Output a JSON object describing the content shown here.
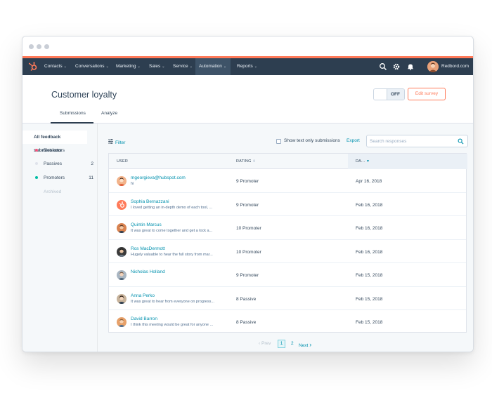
{
  "nav": {
    "items": [
      "Contacts",
      "Conversations",
      "Marketing",
      "Sales",
      "Service",
      "Automation",
      "Reports"
    ],
    "account": "Redbord.com"
  },
  "page": {
    "title": "Customer loyalty",
    "toggle_label": "OFF",
    "edit_button": "Edit survey",
    "tabs": [
      "Submissions",
      "Analyze"
    ]
  },
  "sidebar": {
    "header": "All feedback submissions",
    "items": [
      {
        "label": "Detractors",
        "count": "",
        "color": "#f2547d"
      },
      {
        "label": "Passives",
        "count": "2",
        "color": "#dfe3eb"
      },
      {
        "label": "Promoters",
        "count": "11",
        "color": "#00bda5"
      },
      {
        "label": "Archived",
        "count": "",
        "color": ""
      }
    ]
  },
  "toolbar": {
    "filter": "Filter",
    "checkbox_label": "Show text only submissions",
    "export": "Export",
    "search_placeholder": "Search responses"
  },
  "table": {
    "columns": [
      "USER",
      "RATING",
      "DA..."
    ],
    "rows": [
      {
        "name": "mgeorgieva@hubspot.com",
        "comment": "hi",
        "rating": "9 Promoter",
        "date": "Apr 16, 2018"
      },
      {
        "name": "Sophia Bernazzani",
        "comment": "I loved getting an in-depth demo of each tool, ...",
        "rating": "9 Promoter",
        "date": "Feb 16, 2018"
      },
      {
        "name": "Quintin Marcus",
        "comment": "It was great to come together and get a lock a...",
        "rating": "10 Promoter",
        "date": "Feb 16, 2018"
      },
      {
        "name": "Ros MacDermott",
        "comment": "Hugely valuable to hear the full story from mar...",
        "rating": "10 Promoter",
        "date": "Feb 16, 2018"
      },
      {
        "name": "Nicholas Holland",
        "comment": "",
        "rating": "9 Promoter",
        "date": "Feb 15, 2018"
      },
      {
        "name": "Anna Perko",
        "comment": "It was great to hear from everyone on progress...",
        "rating": "8 Passive",
        "date": "Feb 15, 2018"
      },
      {
        "name": "David Barron",
        "comment": "I think this meeting would be great for anyone ...",
        "rating": "8 Passive",
        "date": "Feb 15, 2018"
      }
    ]
  },
  "pagination": {
    "prev": "Prev",
    "pages": [
      "1",
      "2"
    ],
    "next": "Next"
  },
  "colors": {
    "accent": "#ff7a59",
    "nav_bg": "#2d3e50",
    "link": "#0091ae"
  }
}
